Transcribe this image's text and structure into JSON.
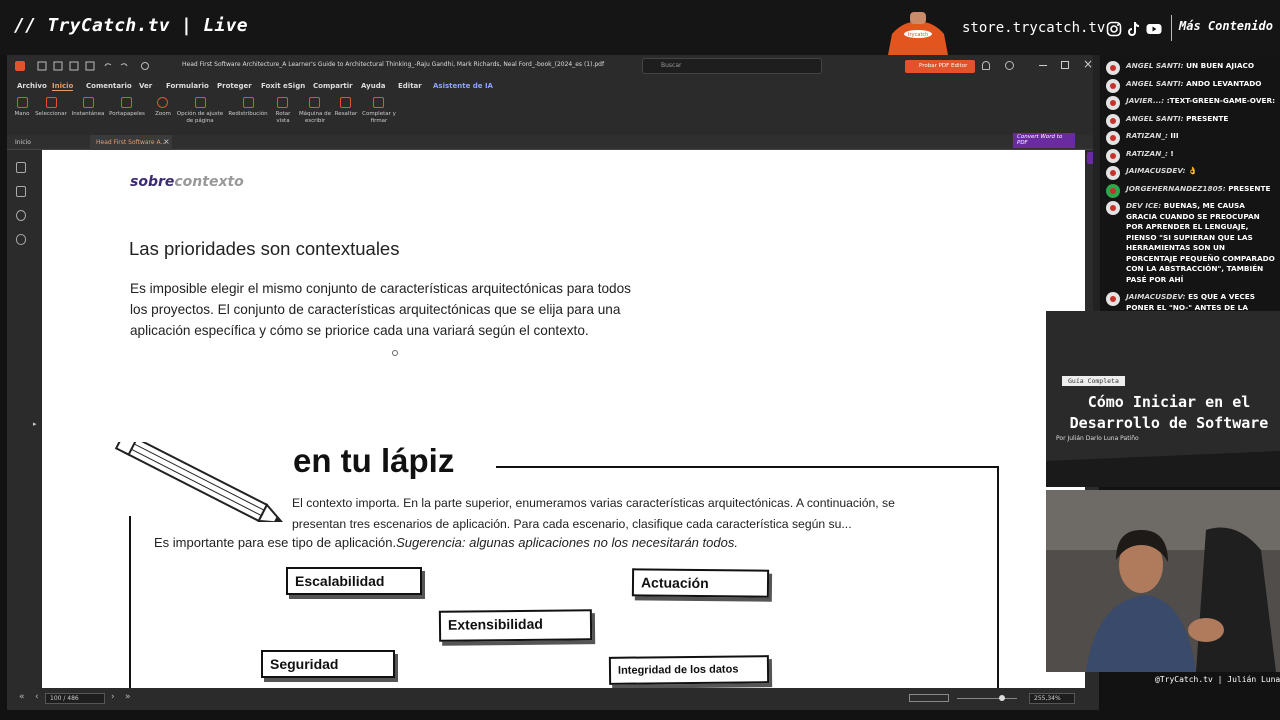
{
  "stream": {
    "brand": "// TryCatch.tv | Live",
    "store": "store.trycatch.tv",
    "more_content": "Más Contenido",
    "socials": [
      "instagram-icon",
      "tiktok-icon",
      "youtube-icon"
    ],
    "cam_label": "@TryCatch.tv | Julián Luna"
  },
  "app": {
    "window_title": "Head First Software Architecture_A Learner's Guide to Architectural Thinking_-Raju Gandhi, Mark Richards, Neal Ford_-book_(2024_es (1).pdf",
    "search_placeholder": "Buscar",
    "pro_editor": "Probar PDF Editor",
    "menu": [
      "Archivo",
      "Inicio",
      "Comentario",
      "Ver",
      "Formulario",
      "Proteger",
      "Foxit eSign",
      "Compartir",
      "Ayuda",
      "Editar",
      "Asistente de IA"
    ],
    "active_menu": "Inicio",
    "tools": [
      "Mano",
      "Seleccionar",
      "Instantánea",
      "Portapapeles",
      "Zoom",
      "Opción de ajuste de página",
      "Redistribución",
      "Rotar vista",
      "Máquina de escribir",
      "Resaltar",
      "Completar y firmar"
    ],
    "convert": "Convert Word to PDF",
    "tabs": [
      "Inicio",
      "Head First Software A..."
    ],
    "page_indicator": "100 / 486",
    "zoom": "255,34%"
  },
  "page": {
    "section_a": "sobre",
    "section_b": "contexto",
    "heading": "Las prioridades son contextuales",
    "paragraph": "Es imposible elegir el mismo conjunto de características arquitectónicas para todos los proyectos. El conjunto de características arquitectónicas que se elija para una aplicación específica y cómo se priorice cada una variará según el contexto.",
    "exercise_title": "en tu lápiz",
    "intro": "El contexto importa. En la parte superior, enumeramos varias características arquitectónicas. A continuación, se presentan tres escenarios de aplicación. Para cada escenario, clasifique cada característica según su...",
    "intro2": "Es importante para ese tipo de aplicación.",
    "intro2_hint": "Sugerencia: algunas aplicaciones no los necesitarán todos.",
    "cards": [
      "Escalabilidad",
      "Actuación",
      "Extensibilidad",
      "Seguridad",
      "Integridad de los datos"
    ]
  },
  "chat": [
    {
      "user": "ANGEL SANTI:",
      "text": " UN BUEN AJIACO"
    },
    {
      "user": "ANGEL SANTI:",
      "text": " ANDO LEVANTADO"
    },
    {
      "user": "JAVIER...:",
      "text": " :TEXT-GREEN-GAME-OVER:"
    },
    {
      "user": "ANGEL SANTI:",
      "text": " PRESENTE"
    },
    {
      "user": "RATIZAN_:",
      "text": " III"
    },
    {
      "user": "RATIZAN_:",
      "text": " !"
    },
    {
      "user": "JAIMACUSDEV:",
      "text": " 👌"
    },
    {
      "user": "JORGEHERNANDEZ1805:",
      "text": " PRESENTE"
    },
    {
      "user": "DEV ICE:",
      "text": " BUENAS, ME CAUSA GRACIA CUANDO SE PREOCUPAN POR APRENDER EL LENGUAJE, PIENSO \"SI SUPIERAN QUE LAS HERRAMIENTAS SON UN PORCENTAJE PEQUEÑO COMPARADO CON LA ABSTRACCIÓN\", TAMBIÉN PASÉ POR AHÍ"
    },
    {
      "user": "JAIMACUSDEV:",
      "text": " ES QUE A VECES PONER EL \"NO-\" ANTES DE LA PALABRA TIENDE A"
    }
  ],
  "ad": {
    "tag": "Guía Completa",
    "title": "Cómo Iniciar en el Desarrollo de Software",
    "author": "Por Julián Darío Luna Patiño"
  }
}
